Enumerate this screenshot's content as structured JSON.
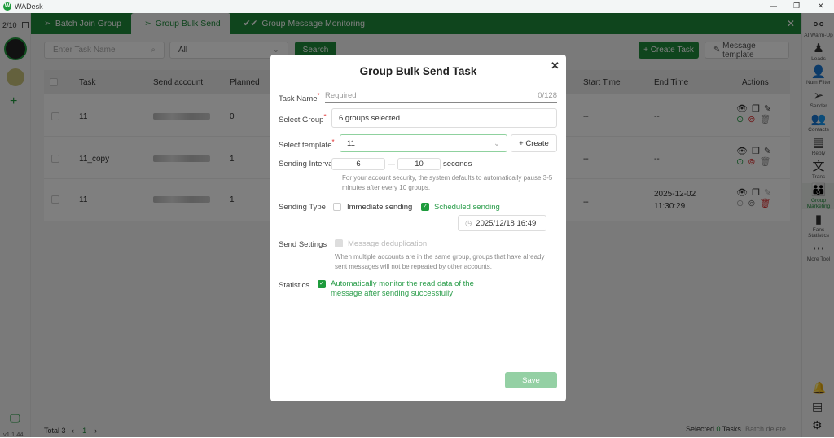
{
  "app": {
    "title": "WADesk",
    "version": "v1.1.44"
  },
  "left": {
    "counter": "2/10"
  },
  "tabs": [
    {
      "label": "Batch Join Group"
    },
    {
      "label": "Group Bulk Send"
    },
    {
      "label": "Group Message Monitoring"
    }
  ],
  "toolbar": {
    "search_placeholder": "Enter Task Name",
    "filter_value": "All",
    "search_label": "Search",
    "create_label": "+ Create Task",
    "template_label": "Message template"
  },
  "table": {
    "headers": [
      "Task",
      "Send account",
      "Planned",
      "Start Time",
      "End Time",
      "Actions"
    ],
    "rows": [
      {
        "task": "11",
        "planned": "0",
        "start": "--",
        "end": "--"
      },
      {
        "task": "11_copy",
        "planned": "1",
        "start": "--",
        "end": "--"
      },
      {
        "task": "11",
        "planned": "1",
        "start": "--",
        "end_date": "2025-12-02",
        "end_time": "11:30:29"
      }
    ]
  },
  "footer": {
    "total": "Total 3",
    "page": "1",
    "selected_prefix": "Selected",
    "selected_count": "0",
    "selected_suffix": "Tasks",
    "batch_delete": "Batch delete"
  },
  "rightbar": [
    {
      "icon": "share-icon",
      "label": "AI Warm-Up"
    },
    {
      "icon": "leads-icon",
      "label": "Leads"
    },
    {
      "icon": "user-search-icon",
      "label": "Num Filter"
    },
    {
      "icon": "send-icon",
      "label": "Sender"
    },
    {
      "icon": "contacts-icon",
      "label": "Contacts"
    },
    {
      "icon": "reply-icon",
      "label": "Reply"
    },
    {
      "icon": "translate-icon",
      "label": "Trans"
    },
    {
      "icon": "group-icon",
      "label": "Group Marketing"
    },
    {
      "icon": "stats-icon",
      "label": "Fans Statistics"
    },
    {
      "icon": "more-icon",
      "label": "More Tool"
    }
  ],
  "modal": {
    "title": "Group Bulk Send Task",
    "task_name_label": "Task Name",
    "task_name_placeholder": "Required",
    "task_name_count": "0/128",
    "group_label": "Select Group",
    "group_value": "6 groups selected",
    "template_label": "Select template",
    "template_value": "11",
    "create_label": "+ Create",
    "interval_label": "Sending Interval",
    "interval_min": "6",
    "interval_sep": "—",
    "interval_max": "10",
    "interval_unit": "seconds",
    "interval_hint": "For your account security, the system defaults to automatically pause 3-5 minutes after every 10 groups.",
    "type_label": "Sending Type",
    "immediate_label": "Immediate sending",
    "scheduled_label": "Scheduled sending",
    "schedule_time": "2025/12/18 16:49",
    "settings_label": "Send Settings",
    "dedup_label": "Message deduplication",
    "dedup_hint": "When multiple accounts are in the same group, groups that have already sent messages will not be repeated by other accounts.",
    "stats_label": "Statistics",
    "stats_option": "Automatically monitor the read data of the message after sending successfully",
    "save_label": "Save"
  },
  "colors": {
    "brand": "#1e8a3a"
  }
}
